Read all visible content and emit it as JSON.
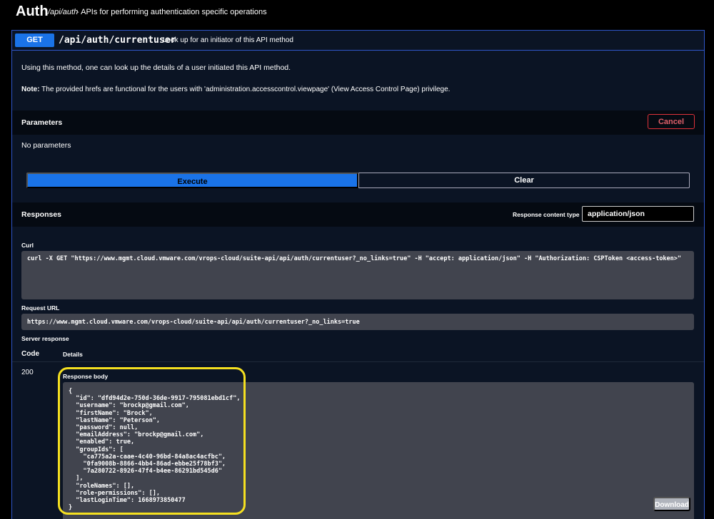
{
  "header": {
    "tag": "Auth",
    "path": "/api/auth",
    "description": "- APIs for performing authentication specific operations"
  },
  "operation": {
    "method": "GET",
    "path": "/api/auth/currentuser",
    "summary": "Look up for an initiator of this API method",
    "description": "Using this method, one can look up the details of a user initiated this API method.",
    "note_label": "Note:",
    "note_text": " The provided hrefs are functional for the users with 'administration.accesscontrol.viewpage' (View Access Control Page) privilege."
  },
  "parameters": {
    "title": "Parameters",
    "cancel_label": "Cancel",
    "empty_text": "No parameters",
    "execute_label": "Execute",
    "clear_label": "Clear"
  },
  "responses": {
    "title": "Responses",
    "content_type_label": "Response content type",
    "content_type_value": "application/json",
    "curl_label": "Curl",
    "curl_command": "curl -X GET \"https://www.mgmt.cloud.vmware.com/vrops-cloud/suite-api/api/auth/currentuser?_no_links=true\" -H \"accept: application/json\" -H \"Authorization: CSPToken <access-token>\"",
    "request_url_label": "Request URL",
    "request_url": "https://www.mgmt.cloud.vmware.com/vrops-cloud/suite-api/api/auth/currentuser?_no_links=true",
    "server_response_label": "Server response",
    "code_header": "Code",
    "details_header": "Details",
    "status_code": "200",
    "response_body_label": "Response body",
    "response_body": "{\n  \"id\": \"dfd94d2e-750d-36de-9917-795081ebd1cf\",\n  \"username\": \"brockp@gmail.com\",\n  \"firstName\": \"Brock\",\n  \"lastName\": \"Peterson\",\n  \"password\": null,\n  \"emailAddress\": \"brockp@gmail.com\",\n  \"enabled\": true,\n  \"groupIds\": [\n    \"ca775a2a-caae-4c40-96bd-84a8ac4acfbc\",\n    \"0fa9008b-8866-4bb4-86ad-ebbe25f78bf3\",\n    \"7a280722-8926-47f4-b4ee-86291bd545d6\"\n  ],\n  \"roleNames\": [],\n  \"role-permissions\": [],\n  \"lastLoginTime\": 1668973850477\n}",
    "download_label": "Download"
  },
  "colors": {
    "method_get": "#1a73e8",
    "border_accent": "#2f56c9",
    "cancel": "#e0323a",
    "highlight": "#f5e020"
  }
}
